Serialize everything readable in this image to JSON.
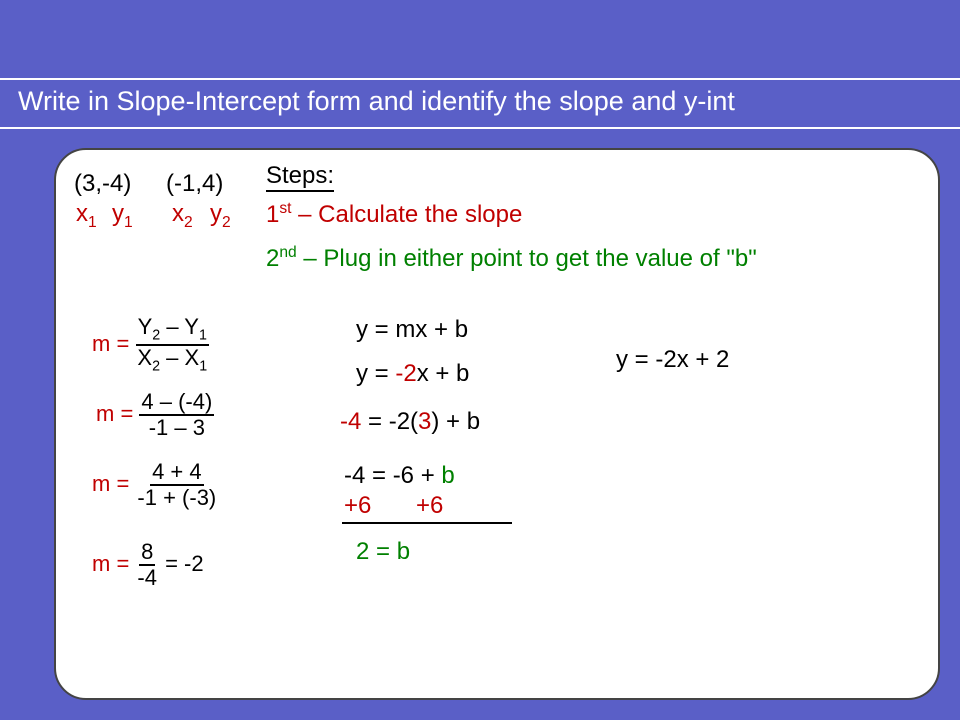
{
  "title": "Write in Slope-Intercept form and identify the slope and y-int",
  "points": {
    "p1": "(3,-4)",
    "p2": "(-1,4)"
  },
  "labels": {
    "x1": "x",
    "y1": "y",
    "x2": "x",
    "y2": "y",
    "s1": "1",
    "s2": "2"
  },
  "steps": {
    "heading": "Steps:",
    "step1_pre": "1",
    "step1_sup": "st",
    "step1_text": " – Calculate the slope",
    "step2_pre": "2",
    "step2_sup": "nd",
    "step2_text": " – Plug in either point to get the value of \"b\""
  },
  "slope": {
    "m_eq": "m = ",
    "f1_num_a": "Y",
    "f1_num_b": " – Y",
    "f1_den_a": "X",
    "f1_den_b": " – X",
    "f2_num": "4 – (-4)",
    "f2_den": "-1 – 3",
    "f3_num": "4 + 4",
    "f3_den": "-1 + (-3)",
    "f4_num": "8",
    "f4_den": "-4",
    "f4_result": " = -2"
  },
  "solve_b": {
    "e1": "y = mx + b",
    "e2a": "y = ",
    "e2b": "-2",
    "e2c": "x + b",
    "e3a": "-4",
    "e3b": " = -2(",
    "e3c": "3",
    "e3d": ") + b",
    "e4a": "-4 = -6 + ",
    "e4b": "b",
    "e5a": "+6",
    "e5b": "+6",
    "e6": "2 = b"
  },
  "final": "y = -2x + 2"
}
